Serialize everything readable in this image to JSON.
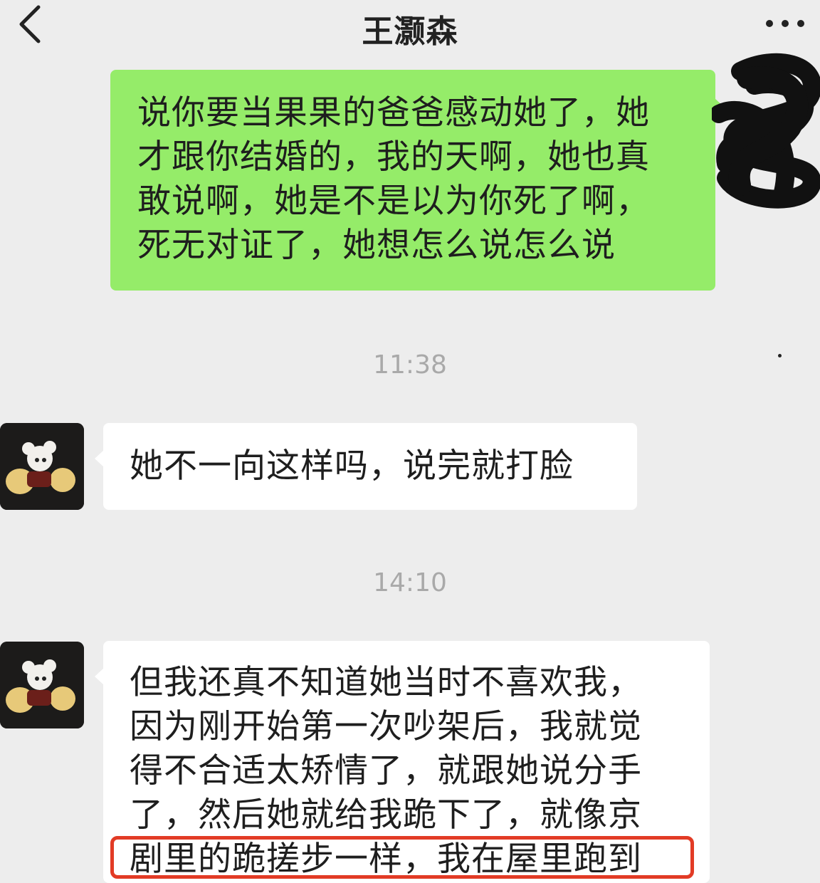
{
  "header": {
    "title": "王灏森",
    "back_icon": "chevron-left-icon",
    "more_icon": "more-dots-icon"
  },
  "messages": [
    {
      "direction": "sent",
      "lines": [
        "说你要当果果的爸爸感动她了，她",
        "才跟你结婚的，我的天啊，她也真",
        "敢说啊，她是不是以为你死了啊，",
        "死无对证了，她想怎么说怎么说"
      ]
    },
    {
      "direction": "received",
      "lines": [
        "她不一向这样吗，说完就打脸"
      ]
    },
    {
      "direction": "received",
      "lines": [
        "但我还真不知道她当时不喜欢我，",
        "因为刚开始第一次吵架后，我就觉",
        "得不合适太矫情了，就跟她说分手",
        "了，然后她就给我跪下了，就像京",
        "剧里的跪搓步一样，我在屋里跑到"
      ]
    }
  ],
  "timestamps": [
    "11:38",
    "14:10"
  ],
  "colors": {
    "background": "#ededed",
    "sent_bubble": "#95ec69",
    "received_bubble": "#ffffff",
    "highlight": "#e23b25"
  }
}
